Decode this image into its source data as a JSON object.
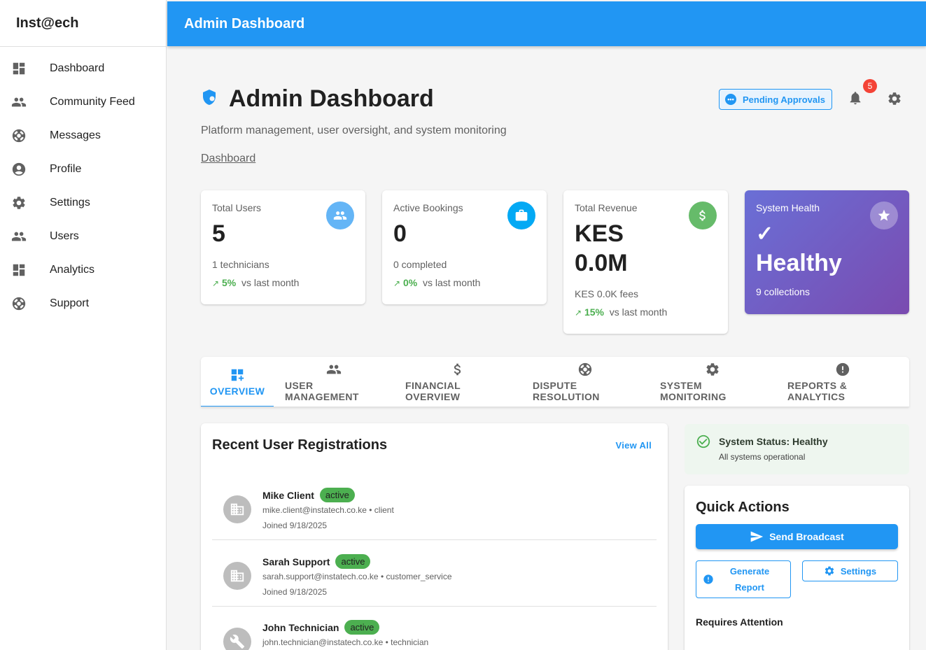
{
  "brand": "Inst@ech",
  "sidebar": {
    "items": [
      {
        "label": "Dashboard",
        "icon": "dashboard-icon"
      },
      {
        "label": "Community Feed",
        "icon": "people-icon"
      },
      {
        "label": "Messages",
        "icon": "support-icon"
      },
      {
        "label": "Profile",
        "icon": "account-icon"
      },
      {
        "label": "Settings",
        "icon": "gear-icon"
      },
      {
        "label": "Users",
        "icon": "people-icon"
      },
      {
        "label": "Analytics",
        "icon": "dashboard-icon"
      },
      {
        "label": "Support",
        "icon": "support-icon"
      }
    ]
  },
  "topbar": {
    "title": "Admin Dashboard"
  },
  "header": {
    "title": "Admin Dashboard",
    "subtitle": "Platform management, user oversight, and system monitoring",
    "breadcrumb": "Dashboard",
    "pending_label": "Pending Approvals",
    "notification_count": "5"
  },
  "stats": [
    {
      "label": "Total Users",
      "value": "5",
      "sub": "1 technicians",
      "trend_pct": "5%",
      "trend_text": "vs last month",
      "color": "#64b5f6"
    },
    {
      "label": "Active Bookings",
      "value": "0",
      "sub": "0 completed",
      "trend_pct": "0%",
      "trend_text": "vs last month",
      "color": "#03a9f4"
    },
    {
      "label": "Total Revenue",
      "value_line1": "KES",
      "value_line2": "0.0M",
      "sub": "KES 0.0K fees",
      "trend_pct": "15%",
      "trend_text": "vs last month",
      "color": "#66bb6a"
    },
    {
      "label": "System Health",
      "check": "✓",
      "value": "Healthy",
      "sub": "9 collections"
    }
  ],
  "trend_arrow": "↗",
  "tabs": [
    {
      "label": "Overview",
      "icon": "dashboard-add-icon",
      "active": true
    },
    {
      "label": "User Management",
      "icon": "people-icon"
    },
    {
      "label": "Financial Overview",
      "icon": "dollar-icon"
    },
    {
      "label": "Dispute Resolution",
      "icon": "support-icon"
    },
    {
      "label": "System Monitoring",
      "icon": "gear-icon"
    },
    {
      "label": "Reports & Analytics",
      "icon": "alert-icon"
    }
  ],
  "recent_users": {
    "title": "Recent User Registrations",
    "view_all": "View All",
    "rows": [
      {
        "name": "Mike Client",
        "status": "active",
        "meta": "mike.client@instatech.co.ke • client",
        "joined": "Joined 9/18/2025",
        "icon": "business-icon"
      },
      {
        "name": "Sarah Support",
        "status": "active",
        "meta": "sarah.support@instatech.co.ke • customer_service",
        "joined": "Joined 9/18/2025",
        "icon": "business-icon"
      },
      {
        "name": "John Technician",
        "status": "active",
        "meta": "john.technician@instatech.co.ke • technician",
        "joined": "",
        "icon": "wrench-icon"
      }
    ]
  },
  "system_status": {
    "title": "System Status: Healthy",
    "detail": "All systems operational"
  },
  "quick_actions": {
    "title": "Quick Actions",
    "broadcast": "Send Broadcast",
    "generate_line1": "Generate",
    "generate_line2": "Report",
    "settings": "Settings",
    "requires_attention": "Requires Attention"
  },
  "colors": {
    "primary": "#2196f3",
    "success": "#4caf50",
    "danger": "#f44336",
    "health_start": "#6a6fd6",
    "health_end": "#7a4bb0"
  }
}
